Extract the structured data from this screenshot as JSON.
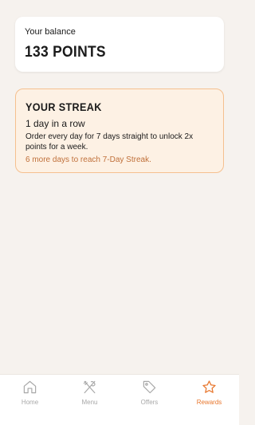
{
  "balance": {
    "label": "Your balance",
    "value": "133 POINTS"
  },
  "streak": {
    "title": "YOUR STREAK",
    "count": "1 day in a row",
    "description": "Order every day for 7 days straight to unlock 2x points for a week.",
    "progress": "6 more days to reach 7-Day Streak."
  },
  "tabs": [
    {
      "label": "Home",
      "icon": "home-icon",
      "active": false
    },
    {
      "label": "Menu",
      "icon": "fork-knife-icon",
      "active": false
    },
    {
      "label": "Offers",
      "icon": "tag-icon",
      "active": false
    },
    {
      "label": "Rewards",
      "icon": "star-icon",
      "active": true
    }
  ],
  "colors": {
    "accent": "#e8772e",
    "inactive": "#a8a8a8",
    "background": "#f6f2ee",
    "streak_bg": "#fdf1e4",
    "streak_border": "#f5c08f"
  }
}
